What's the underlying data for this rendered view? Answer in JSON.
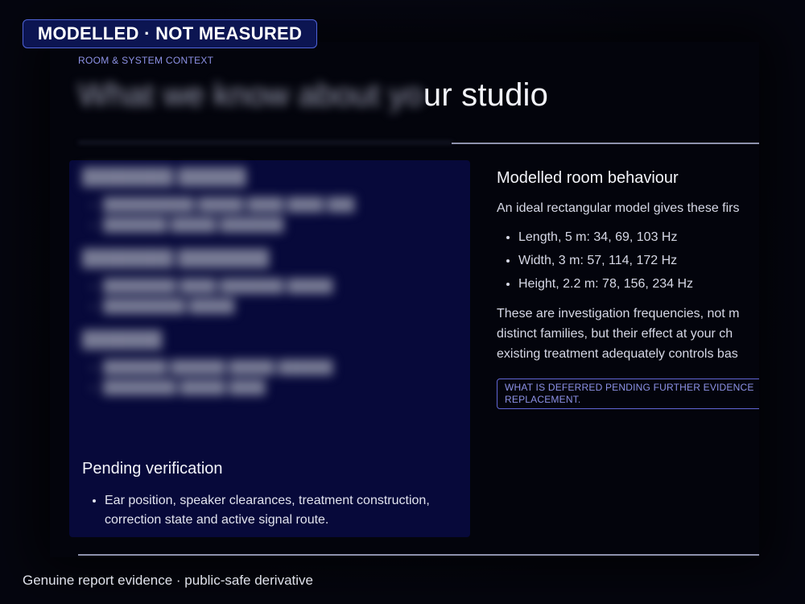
{
  "badge": "MODELLED · NOT MEASURED",
  "caption": "Genuine report evidence · public-safe derivative",
  "card": {
    "eyebrow": "ROOM & SYSTEM CONTEXT",
    "title_hidden": "What we know about yo",
    "title_visible": "ur studio"
  },
  "left_panel": {
    "pending": {
      "heading": "Pending verification",
      "item": "Ear position, speaker clearances, treatment construction, correction state and active signal route."
    }
  },
  "right_panel": {
    "heading": "Modelled room behaviour",
    "intro": "An ideal rectangular model gives these firs",
    "modes": [
      "Length, 5 m: 34, 69, 103 Hz",
      "Width, 3 m: 57, 114, 172 Hz",
      "Height, 2.2 m: 78, 156, 234 Hz"
    ],
    "note_lines": [
      "These are investigation frequencies, not m",
      "distinct families, but their effect at your ch",
      "existing treatment adequately controls bas"
    ],
    "deferred_lines": [
      "WHAT IS DEFERRED PENDING FURTHER EVIDENCE",
      "REPLACEMENT."
    ]
  }
}
